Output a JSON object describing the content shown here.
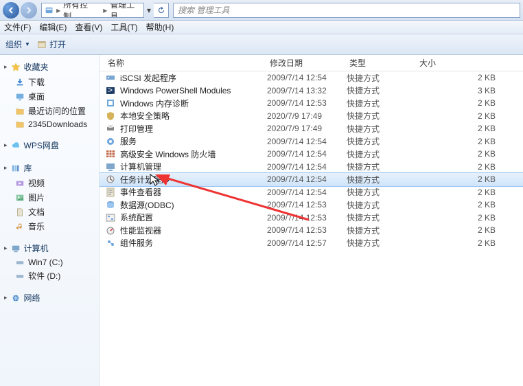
{
  "titlebar": {
    "breadcrumb": {
      "folder1": "所有控制...",
      "folder2": "管理工具"
    },
    "search_placeholder": "搜索 管理工具"
  },
  "menubar": [
    "文件(F)",
    "编辑(E)",
    "查看(V)",
    "工具(T)",
    "帮助(H)"
  ],
  "toolbar": {
    "organize": "组织",
    "open": "打开"
  },
  "sidebar": {
    "fav_title": "收藏夹",
    "fav_items": [
      "下载",
      "桌面",
      "最近访问的位置",
      "2345Downloads"
    ],
    "wps": "WPS网盘",
    "lib_title": "库",
    "lib_items": [
      "视频",
      "图片",
      "文档",
      "音乐"
    ],
    "computer_title": "计算机",
    "computer_items": [
      "Win7 (C:)",
      "软件 (D:)"
    ],
    "network": "网络"
  },
  "columns": {
    "name": "名称",
    "date": "修改日期",
    "type": "类型",
    "size": "大小"
  },
  "rows": [
    {
      "name": "iSCSI 发起程序",
      "date": "2009/7/14 12:54",
      "type": "快捷方式",
      "size": "2 KB",
      "icon": "iscsi"
    },
    {
      "name": "Windows PowerShell Modules",
      "date": "2009/7/14 13:32",
      "type": "快捷方式",
      "size": "3 KB",
      "icon": "ps"
    },
    {
      "name": "Windows 内存诊断",
      "date": "2009/7/14 12:53",
      "type": "快捷方式",
      "size": "2 KB",
      "icon": "mem"
    },
    {
      "name": "本地安全策略",
      "date": "2020/7/9 17:49",
      "type": "快捷方式",
      "size": "2 KB",
      "icon": "sec"
    },
    {
      "name": "打印管理",
      "date": "2020/7/9 17:49",
      "type": "快捷方式",
      "size": "2 KB",
      "icon": "print"
    },
    {
      "name": "服务",
      "date": "2009/7/14 12:54",
      "type": "快捷方式",
      "size": "2 KB",
      "icon": "svc"
    },
    {
      "name": "高级安全 Windows 防火墙",
      "date": "2009/7/14 12:54",
      "type": "快捷方式",
      "size": "2 KB",
      "icon": "fw"
    },
    {
      "name": "计算机管理",
      "date": "2009/7/14 12:54",
      "type": "快捷方式",
      "size": "2 KB",
      "icon": "mgmt"
    },
    {
      "name": "任务计划程序",
      "date": "2009/7/14 12:54",
      "type": "快捷方式",
      "size": "2 KB",
      "icon": "task",
      "selected": true
    },
    {
      "name": "事件查看器",
      "date": "2009/7/14 12:54",
      "type": "快捷方式",
      "size": "2 KB",
      "icon": "evt"
    },
    {
      "name": "数据源(ODBC)",
      "date": "2009/7/14 12:53",
      "type": "快捷方式",
      "size": "2 KB",
      "icon": "odbc"
    },
    {
      "name": "系统配置",
      "date": "2009/7/14 12:53",
      "type": "快捷方式",
      "size": "2 KB",
      "icon": "cfg"
    },
    {
      "name": "性能监视器",
      "date": "2009/7/14 12:53",
      "type": "快捷方式",
      "size": "2 KB",
      "icon": "perf"
    },
    {
      "name": "组件服务",
      "date": "2009/7/14 12:57",
      "type": "快捷方式",
      "size": "2 KB",
      "icon": "comp"
    }
  ]
}
